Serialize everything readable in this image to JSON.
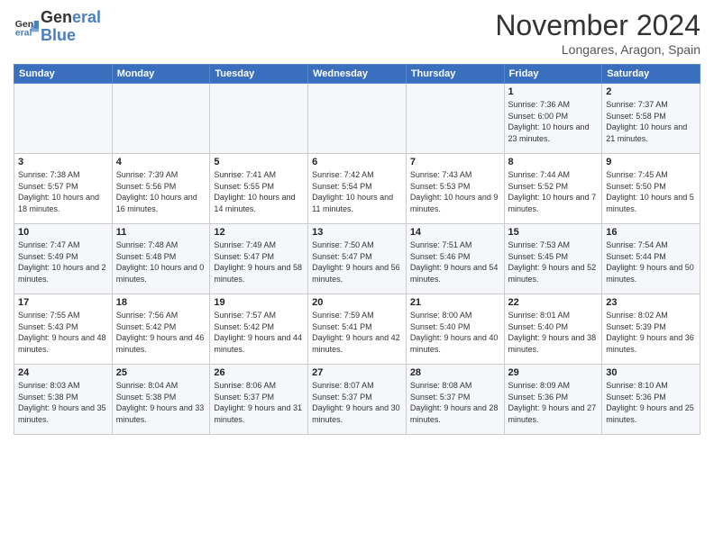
{
  "logo": {
    "line1": "General",
    "line2": "Blue"
  },
  "title": "November 2024",
  "location": "Longares, Aragon, Spain",
  "days_of_week": [
    "Sunday",
    "Monday",
    "Tuesday",
    "Wednesday",
    "Thursday",
    "Friday",
    "Saturday"
  ],
  "weeks": [
    [
      {
        "num": "",
        "info": ""
      },
      {
        "num": "",
        "info": ""
      },
      {
        "num": "",
        "info": ""
      },
      {
        "num": "",
        "info": ""
      },
      {
        "num": "",
        "info": ""
      },
      {
        "num": "1",
        "info": "Sunrise: 7:36 AM\nSunset: 6:00 PM\nDaylight: 10 hours and 23 minutes."
      },
      {
        "num": "2",
        "info": "Sunrise: 7:37 AM\nSunset: 5:58 PM\nDaylight: 10 hours and 21 minutes."
      }
    ],
    [
      {
        "num": "3",
        "info": "Sunrise: 7:38 AM\nSunset: 5:57 PM\nDaylight: 10 hours and 18 minutes."
      },
      {
        "num": "4",
        "info": "Sunrise: 7:39 AM\nSunset: 5:56 PM\nDaylight: 10 hours and 16 minutes."
      },
      {
        "num": "5",
        "info": "Sunrise: 7:41 AM\nSunset: 5:55 PM\nDaylight: 10 hours and 14 minutes."
      },
      {
        "num": "6",
        "info": "Sunrise: 7:42 AM\nSunset: 5:54 PM\nDaylight: 10 hours and 11 minutes."
      },
      {
        "num": "7",
        "info": "Sunrise: 7:43 AM\nSunset: 5:53 PM\nDaylight: 10 hours and 9 minutes."
      },
      {
        "num": "8",
        "info": "Sunrise: 7:44 AM\nSunset: 5:52 PM\nDaylight: 10 hours and 7 minutes."
      },
      {
        "num": "9",
        "info": "Sunrise: 7:45 AM\nSunset: 5:50 PM\nDaylight: 10 hours and 5 minutes."
      }
    ],
    [
      {
        "num": "10",
        "info": "Sunrise: 7:47 AM\nSunset: 5:49 PM\nDaylight: 10 hours and 2 minutes."
      },
      {
        "num": "11",
        "info": "Sunrise: 7:48 AM\nSunset: 5:48 PM\nDaylight: 10 hours and 0 minutes."
      },
      {
        "num": "12",
        "info": "Sunrise: 7:49 AM\nSunset: 5:47 PM\nDaylight: 9 hours and 58 minutes."
      },
      {
        "num": "13",
        "info": "Sunrise: 7:50 AM\nSunset: 5:47 PM\nDaylight: 9 hours and 56 minutes."
      },
      {
        "num": "14",
        "info": "Sunrise: 7:51 AM\nSunset: 5:46 PM\nDaylight: 9 hours and 54 minutes."
      },
      {
        "num": "15",
        "info": "Sunrise: 7:53 AM\nSunset: 5:45 PM\nDaylight: 9 hours and 52 minutes."
      },
      {
        "num": "16",
        "info": "Sunrise: 7:54 AM\nSunset: 5:44 PM\nDaylight: 9 hours and 50 minutes."
      }
    ],
    [
      {
        "num": "17",
        "info": "Sunrise: 7:55 AM\nSunset: 5:43 PM\nDaylight: 9 hours and 48 minutes."
      },
      {
        "num": "18",
        "info": "Sunrise: 7:56 AM\nSunset: 5:42 PM\nDaylight: 9 hours and 46 minutes."
      },
      {
        "num": "19",
        "info": "Sunrise: 7:57 AM\nSunset: 5:42 PM\nDaylight: 9 hours and 44 minutes."
      },
      {
        "num": "20",
        "info": "Sunrise: 7:59 AM\nSunset: 5:41 PM\nDaylight: 9 hours and 42 minutes."
      },
      {
        "num": "21",
        "info": "Sunrise: 8:00 AM\nSunset: 5:40 PM\nDaylight: 9 hours and 40 minutes."
      },
      {
        "num": "22",
        "info": "Sunrise: 8:01 AM\nSunset: 5:40 PM\nDaylight: 9 hours and 38 minutes."
      },
      {
        "num": "23",
        "info": "Sunrise: 8:02 AM\nSunset: 5:39 PM\nDaylight: 9 hours and 36 minutes."
      }
    ],
    [
      {
        "num": "24",
        "info": "Sunrise: 8:03 AM\nSunset: 5:38 PM\nDaylight: 9 hours and 35 minutes."
      },
      {
        "num": "25",
        "info": "Sunrise: 8:04 AM\nSunset: 5:38 PM\nDaylight: 9 hours and 33 minutes."
      },
      {
        "num": "26",
        "info": "Sunrise: 8:06 AM\nSunset: 5:37 PM\nDaylight: 9 hours and 31 minutes."
      },
      {
        "num": "27",
        "info": "Sunrise: 8:07 AM\nSunset: 5:37 PM\nDaylight: 9 hours and 30 minutes."
      },
      {
        "num": "28",
        "info": "Sunrise: 8:08 AM\nSunset: 5:37 PM\nDaylight: 9 hours and 28 minutes."
      },
      {
        "num": "29",
        "info": "Sunrise: 8:09 AM\nSunset: 5:36 PM\nDaylight: 9 hours and 27 minutes."
      },
      {
        "num": "30",
        "info": "Sunrise: 8:10 AM\nSunset: 5:36 PM\nDaylight: 9 hours and 25 minutes."
      }
    ]
  ]
}
